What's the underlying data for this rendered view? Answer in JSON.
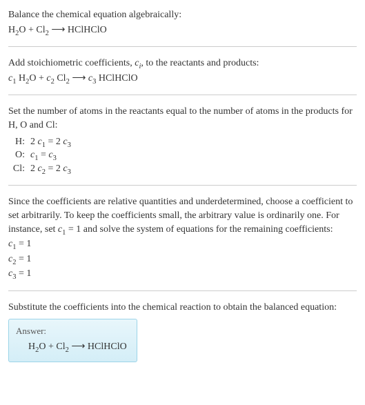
{
  "intro": {
    "title": "Balance the chemical equation algebraically:"
  },
  "eq1": {
    "h2o1": "H",
    "h2o2": "2",
    "h2o3": "O + Cl",
    "cl2sub": "2",
    "arrow": "  ⟶  HClHClO"
  },
  "step2": {
    "text1": "Add stoichiometric coefficients, ",
    "ci_c": "c",
    "ci_i": "i",
    "text2": ", to the reactants and products:"
  },
  "eq2": {
    "c1c": "c",
    "c1s": "1",
    "p1a": " H",
    "p1b": "2",
    "p1c": "O + ",
    "c2c": "c",
    "c2s": "2",
    "p2a": " Cl",
    "p2b": "2",
    "arrow": "  ⟶  ",
    "c3c": "c",
    "c3s": "3",
    "p3": " HClHClO"
  },
  "step3": {
    "text": "Set the number of atoms in the reactants equal to the number of atoms in the products for H, O and Cl:"
  },
  "balance": [
    {
      "label": "H:",
      "lhs_a": "2 ",
      "lhs_c": "c",
      "lhs_s": "1",
      "eq": " = 2 ",
      "rhs_c": "c",
      "rhs_s": "3"
    },
    {
      "label": "O:",
      "lhs_a": "",
      "lhs_c": "c",
      "lhs_s": "1",
      "eq": " = ",
      "rhs_c": "c",
      "rhs_s": "3"
    },
    {
      "label": "Cl:",
      "lhs_a": "2 ",
      "lhs_c": "c",
      "lhs_s": "2",
      "eq": " = 2 ",
      "rhs_c": "c",
      "rhs_s": "3"
    }
  ],
  "step4": {
    "text1": "Since the coefficients are relative quantities and underdetermined, choose a coefficient to set arbitrarily. To keep the coefficients small, the arbitrary value is ordinarily one. For instance, set ",
    "c1c": "c",
    "c1s": "1",
    "text2": " = 1 and solve the system of equations for the remaining coefficients:"
  },
  "solns": [
    {
      "c": "c",
      "s": "1",
      "v": " = 1"
    },
    {
      "c": "c",
      "s": "2",
      "v": " = 1"
    },
    {
      "c": "c",
      "s": "3",
      "v": " = 1"
    }
  ],
  "step5": {
    "text": "Substitute the coefficients into the chemical reaction to obtain the balanced equation:"
  },
  "answer": {
    "label": "Answer:",
    "h1": "H",
    "h2": "2",
    "h3": "O + Cl",
    "cl2": "2",
    "arrow": "  ⟶  HClHClO"
  }
}
